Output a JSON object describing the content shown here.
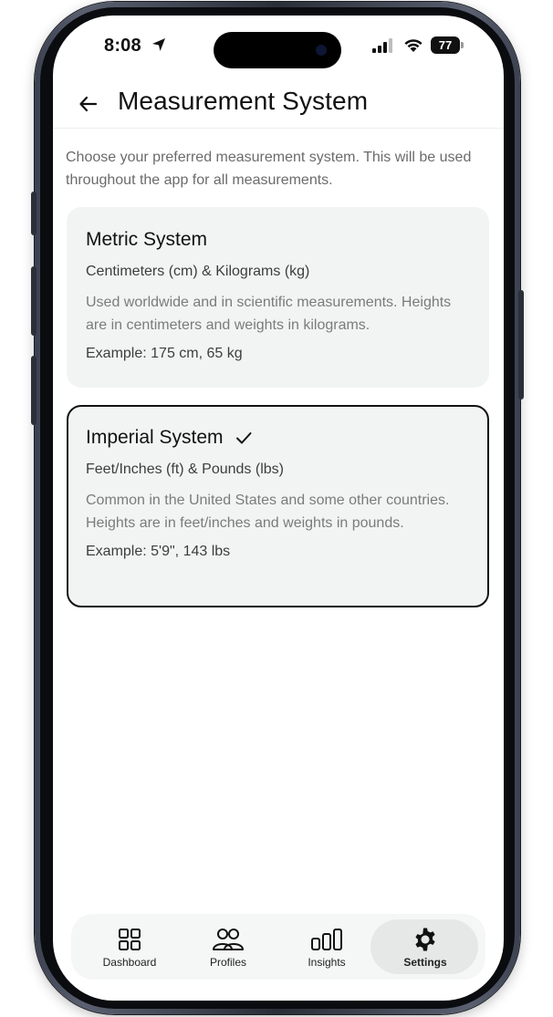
{
  "status_bar": {
    "time": "8:08",
    "battery": "77"
  },
  "header": {
    "title": "Measurement System"
  },
  "intro": "Choose your preferred measurement system. This will be used throughout the app for all measurements.",
  "options": [
    {
      "title": "Metric System",
      "units": "Centimeters (cm) & Kilograms (kg)",
      "description": "Used worldwide and in scientific measurements. Heights are in centimeters and weights in kilograms.",
      "example": "Example: 175 cm, 65 kg",
      "selected": false
    },
    {
      "title": "Imperial System",
      "units": "Feet/Inches (ft) & Pounds (lbs)",
      "description": "Common in the United States and some other countries. Heights are in feet/inches and weights in pounds.",
      "example": "Example: 5'9\", 143 lbs",
      "selected": true
    }
  ],
  "nav": {
    "items": [
      {
        "label": "Dashboard",
        "icon": "grid-icon"
      },
      {
        "label": "Profiles",
        "icon": "users-icon"
      },
      {
        "label": "Insights",
        "icon": "bar-chart-icon"
      },
      {
        "label": "Settings",
        "icon": "gear-icon"
      }
    ],
    "active": "Settings"
  },
  "colors": {
    "card_bg": "#f2f4f4",
    "selected_border": "#111111",
    "text_primary": "#111111",
    "text_muted": "#7b7b7b"
  }
}
